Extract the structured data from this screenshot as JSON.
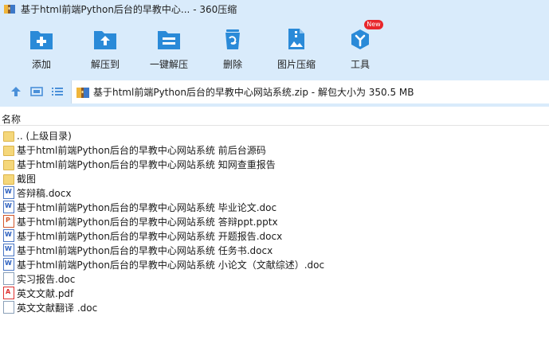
{
  "window": {
    "title": "基于html前端Python后台的早教中心... - 360压缩"
  },
  "toolbar": {
    "items": [
      {
        "label": "添加",
        "icon": "add-icon"
      },
      {
        "label": "解压到",
        "icon": "extract-to-icon"
      },
      {
        "label": "一键解压",
        "icon": "one-click-extract-icon"
      },
      {
        "label": "删除",
        "icon": "delete-icon"
      },
      {
        "label": "图片压缩",
        "icon": "image-compress-icon"
      },
      {
        "label": "工具",
        "icon": "tools-icon",
        "badge": "New"
      }
    ]
  },
  "address": {
    "path": "基于html前端Python后台的早教中心网站系统.zip - 解包大小为 350.5 MB"
  },
  "columns": {
    "name": "名称"
  },
  "files": [
    {
      "name": ".. (上级目录)",
      "type": "folder"
    },
    {
      "name": "基于html前端Python后台的早教中心网站系统 前后台源码",
      "type": "folder"
    },
    {
      "name": "基于html前端Python后台的早教中心网站系统 知网查重报告",
      "type": "folder"
    },
    {
      "name": "截图",
      "type": "folder"
    },
    {
      "name": "答辩稿.docx",
      "type": "docx"
    },
    {
      "name": "基于html前端Python后台的早教中心网站系统 毕业论文.doc",
      "type": "docx"
    },
    {
      "name": "基于html前端Python后台的早教中心网站系统 答辩ppt.pptx",
      "type": "pptx"
    },
    {
      "name": "基于html前端Python后台的早教中心网站系统 开题报告.docx",
      "type": "docx"
    },
    {
      "name": "基于html前端Python后台的早教中心网站系统 任务书.docx",
      "type": "docx"
    },
    {
      "name": "基于html前端Python后台的早教中心网站系统 小论文（文献综述）.doc",
      "type": "docx"
    },
    {
      "name": "实习报告.doc",
      "type": "file"
    },
    {
      "name": "英文文献.pdf",
      "type": "pdf"
    },
    {
      "name": "英文文献翻译 .doc",
      "type": "file"
    }
  ],
  "colors": {
    "chrome": "#d9ebfb",
    "accent": "#2a8ad8",
    "badge": "#e8262b"
  }
}
